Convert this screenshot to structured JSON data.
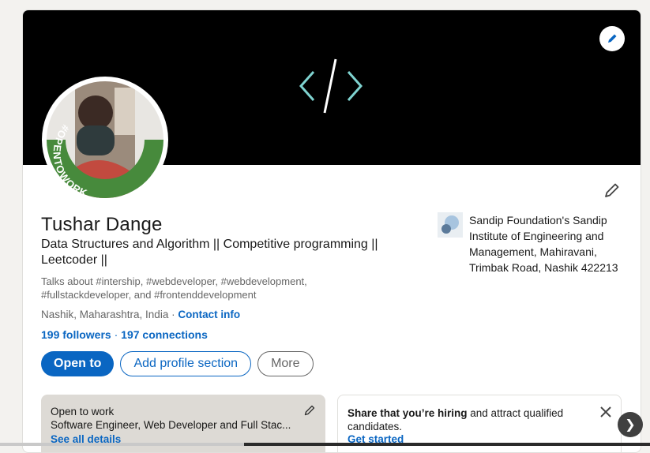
{
  "profile": {
    "name": "Tushar Dange",
    "headline": "Data Structures and Algorithm || Competitive programming || Leetcoder ||",
    "talks_about": "Talks about #intership, #webdeveloper, #webdevelopment, #fullstackdeveloper, and #frontenddevelopment",
    "location": "Nashik, Maharashtra, India",
    "location_sep": " · ",
    "contact_info": "Contact info",
    "followers": "199 followers",
    "connections_sep": " · ",
    "connections": "197 connections",
    "avatar_badge": "#OPENTOWORK",
    "education": "Sandip Foundation's Sandip Institute of Engineering and Management, Mahiravani, Trimbak Road, Nashik 422213"
  },
  "actions": {
    "open_to": "Open to",
    "add_section": "Add profile section",
    "more": "More"
  },
  "open_to_work_card": {
    "title": "Open to work",
    "description": "Software Engineer, Web Developer and Full Stac...",
    "link": "See all details"
  },
  "hiring_card": {
    "bold": "Share that you’re hiring",
    "rest": " and attract qualified candidates.",
    "link": "Get started"
  },
  "icons": {
    "banner_edit": "pencil-icon",
    "intro_edit": "pencil-icon",
    "close": "close-icon",
    "next": "chevron-right-icon",
    "banner_art": "code-brackets-icon"
  },
  "colors": {
    "brand_blue": "#0a66c2",
    "opentowork_green": "#478a3c",
    "banner": "#000000"
  }
}
